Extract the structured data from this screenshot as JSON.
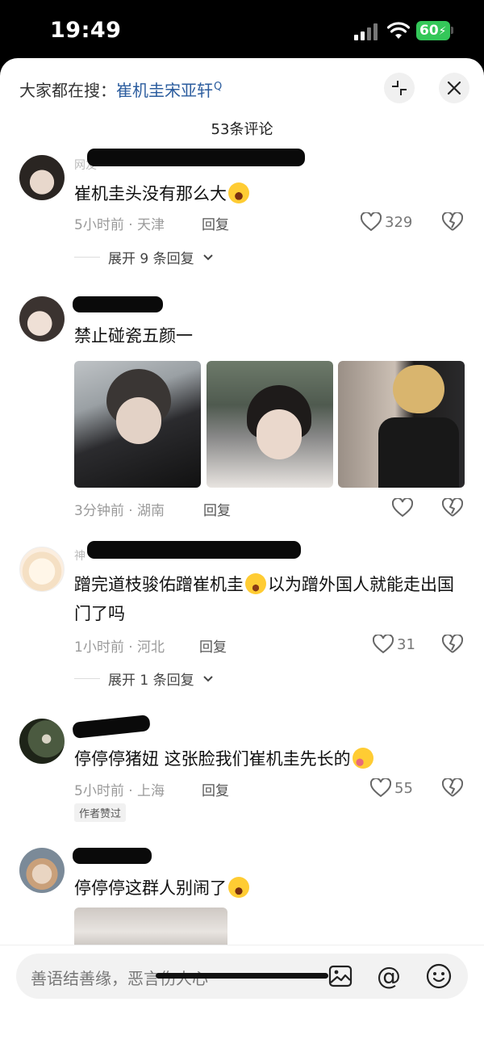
{
  "status": {
    "time": "19:49",
    "battery": "60"
  },
  "header": {
    "search_prefix": "大家都在搜：",
    "search_term": "崔机圭宋亚轩",
    "count": "53条评论"
  },
  "comments": [
    {
      "name": "网友·",
      "text": "崔机圭头没有那么大",
      "time": "5小时前 · 天津",
      "reply": "回复",
      "likes": "329",
      "expand": "展开 9 条回复"
    },
    {
      "text": "禁止碰瓷五颜一",
      "time": "3分钟前 · 湖南",
      "reply": "回复",
      "likes": ""
    },
    {
      "name": "神",
      "text_a": "蹭完道枝骏佑蹭崔机圭",
      "text_b": "以为蹭外国人就能走出国门了吗",
      "time": "1小时前 · 河北",
      "reply": "回复",
      "likes": "31",
      "expand": "展开 1 条回复"
    },
    {
      "text": "停停停猪妞 这张脸我们崔机圭先长的",
      "time": "5小时前 · 上海",
      "reply": "回复",
      "likes": "55",
      "badge": "作者赞过"
    },
    {
      "text": "停停停这群人别闹了"
    }
  ],
  "input": {
    "placeholder": "善语结善缘，恶言伤人心"
  }
}
